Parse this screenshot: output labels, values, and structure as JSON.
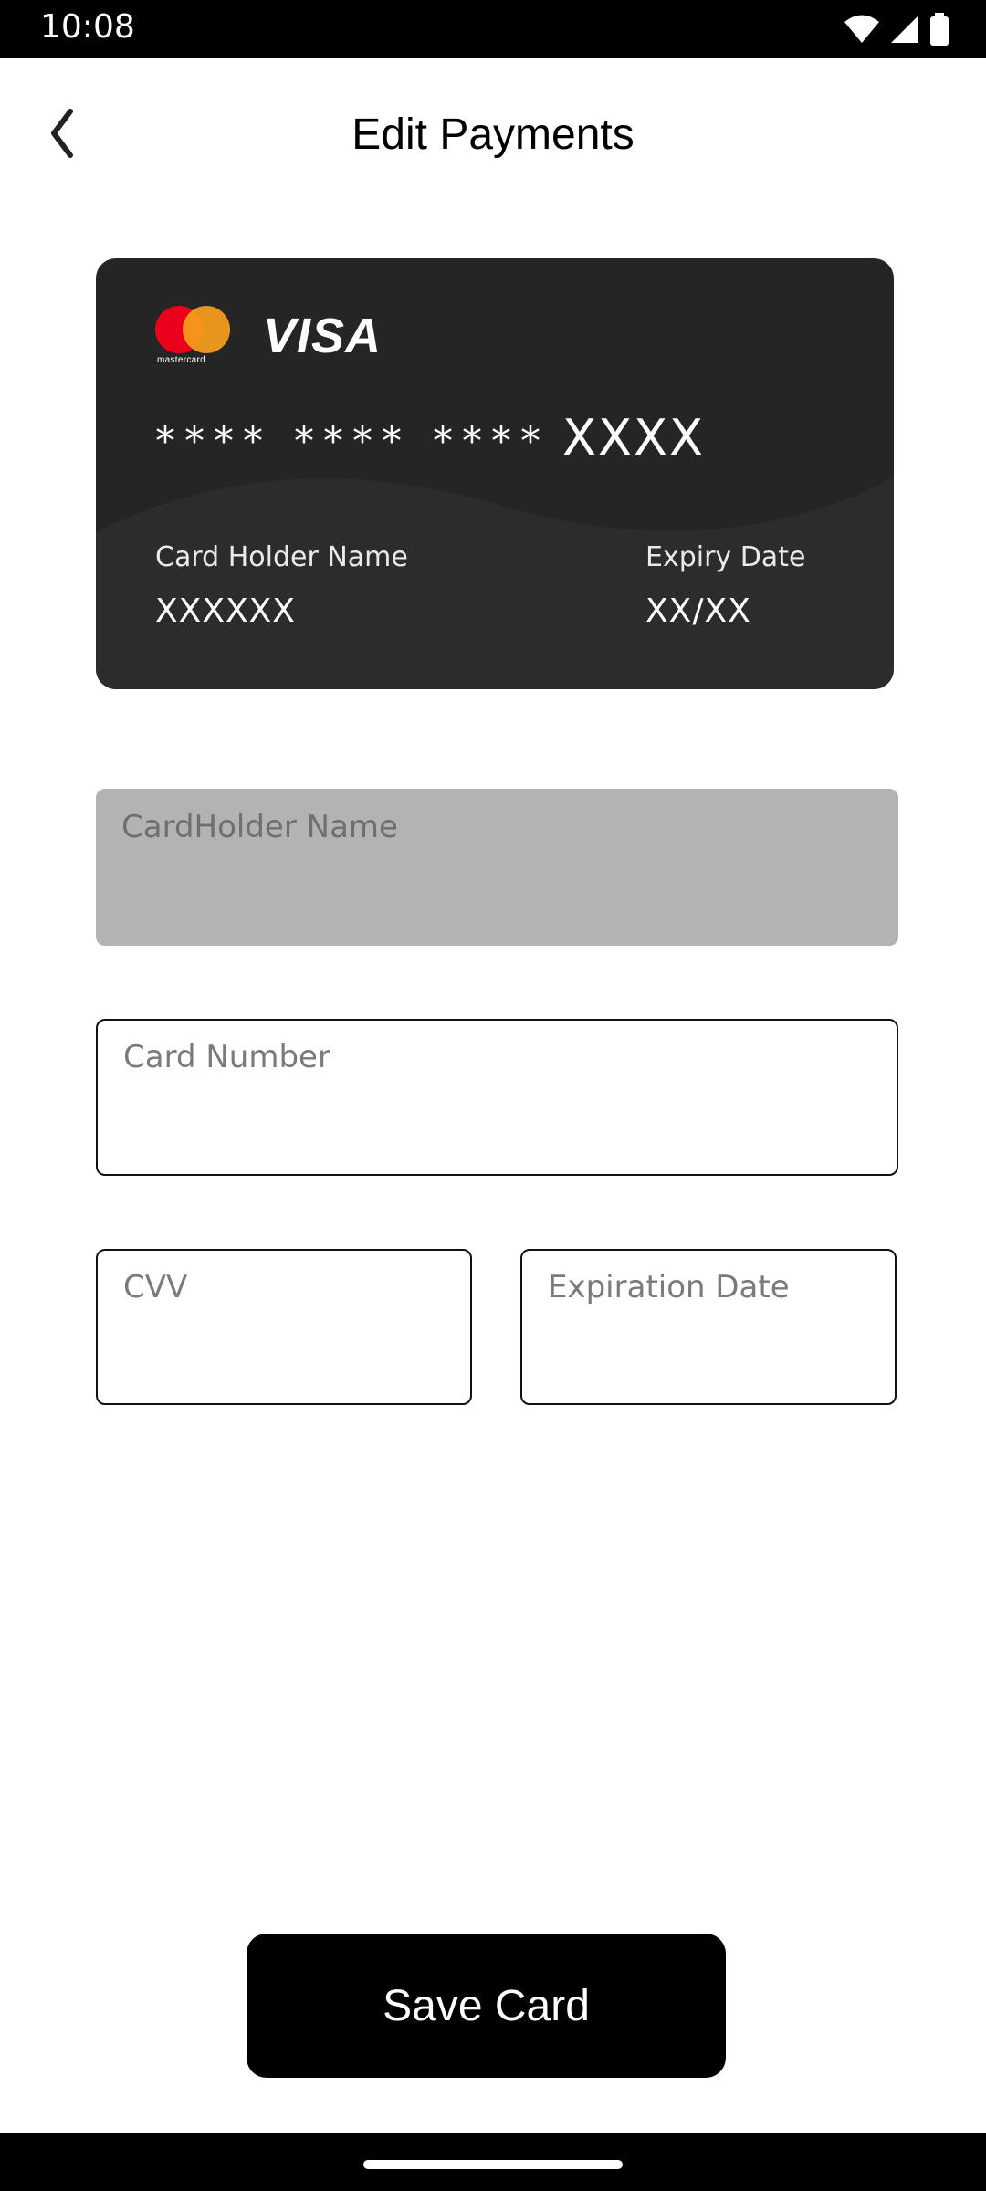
{
  "status_bar": {
    "time": "10:08",
    "icons": [
      "wifi-icon",
      "signal-icon",
      "battery-icon"
    ]
  },
  "header": {
    "title": "Edit Payments",
    "back_icon": "chevron-left-icon"
  },
  "card": {
    "brands": [
      "mastercard",
      "VISA"
    ],
    "mastercard_text": "mastercard",
    "visa_text": "VISA",
    "masked_number": "**** **** ****",
    "last_digits": "XXXX",
    "holder_label": "Card Holder Name",
    "holder_value": "XXXXXX",
    "expiry_label": "Expiry Date",
    "expiry_value": "XX/XX",
    "background_color": "#252525"
  },
  "form": {
    "cardholder_name": {
      "placeholder": "CardHolder Name",
      "value": "",
      "disabled": true
    },
    "card_number": {
      "placeholder": "Card Number",
      "value": ""
    },
    "cvv": {
      "placeholder": "CVV",
      "value": ""
    },
    "expiration_date": {
      "placeholder": "Expiration Date",
      "value": ""
    }
  },
  "actions": {
    "save_label": "Save Card"
  },
  "colors": {
    "primary": "#000000",
    "disabled_field": "#b3b3b3"
  }
}
